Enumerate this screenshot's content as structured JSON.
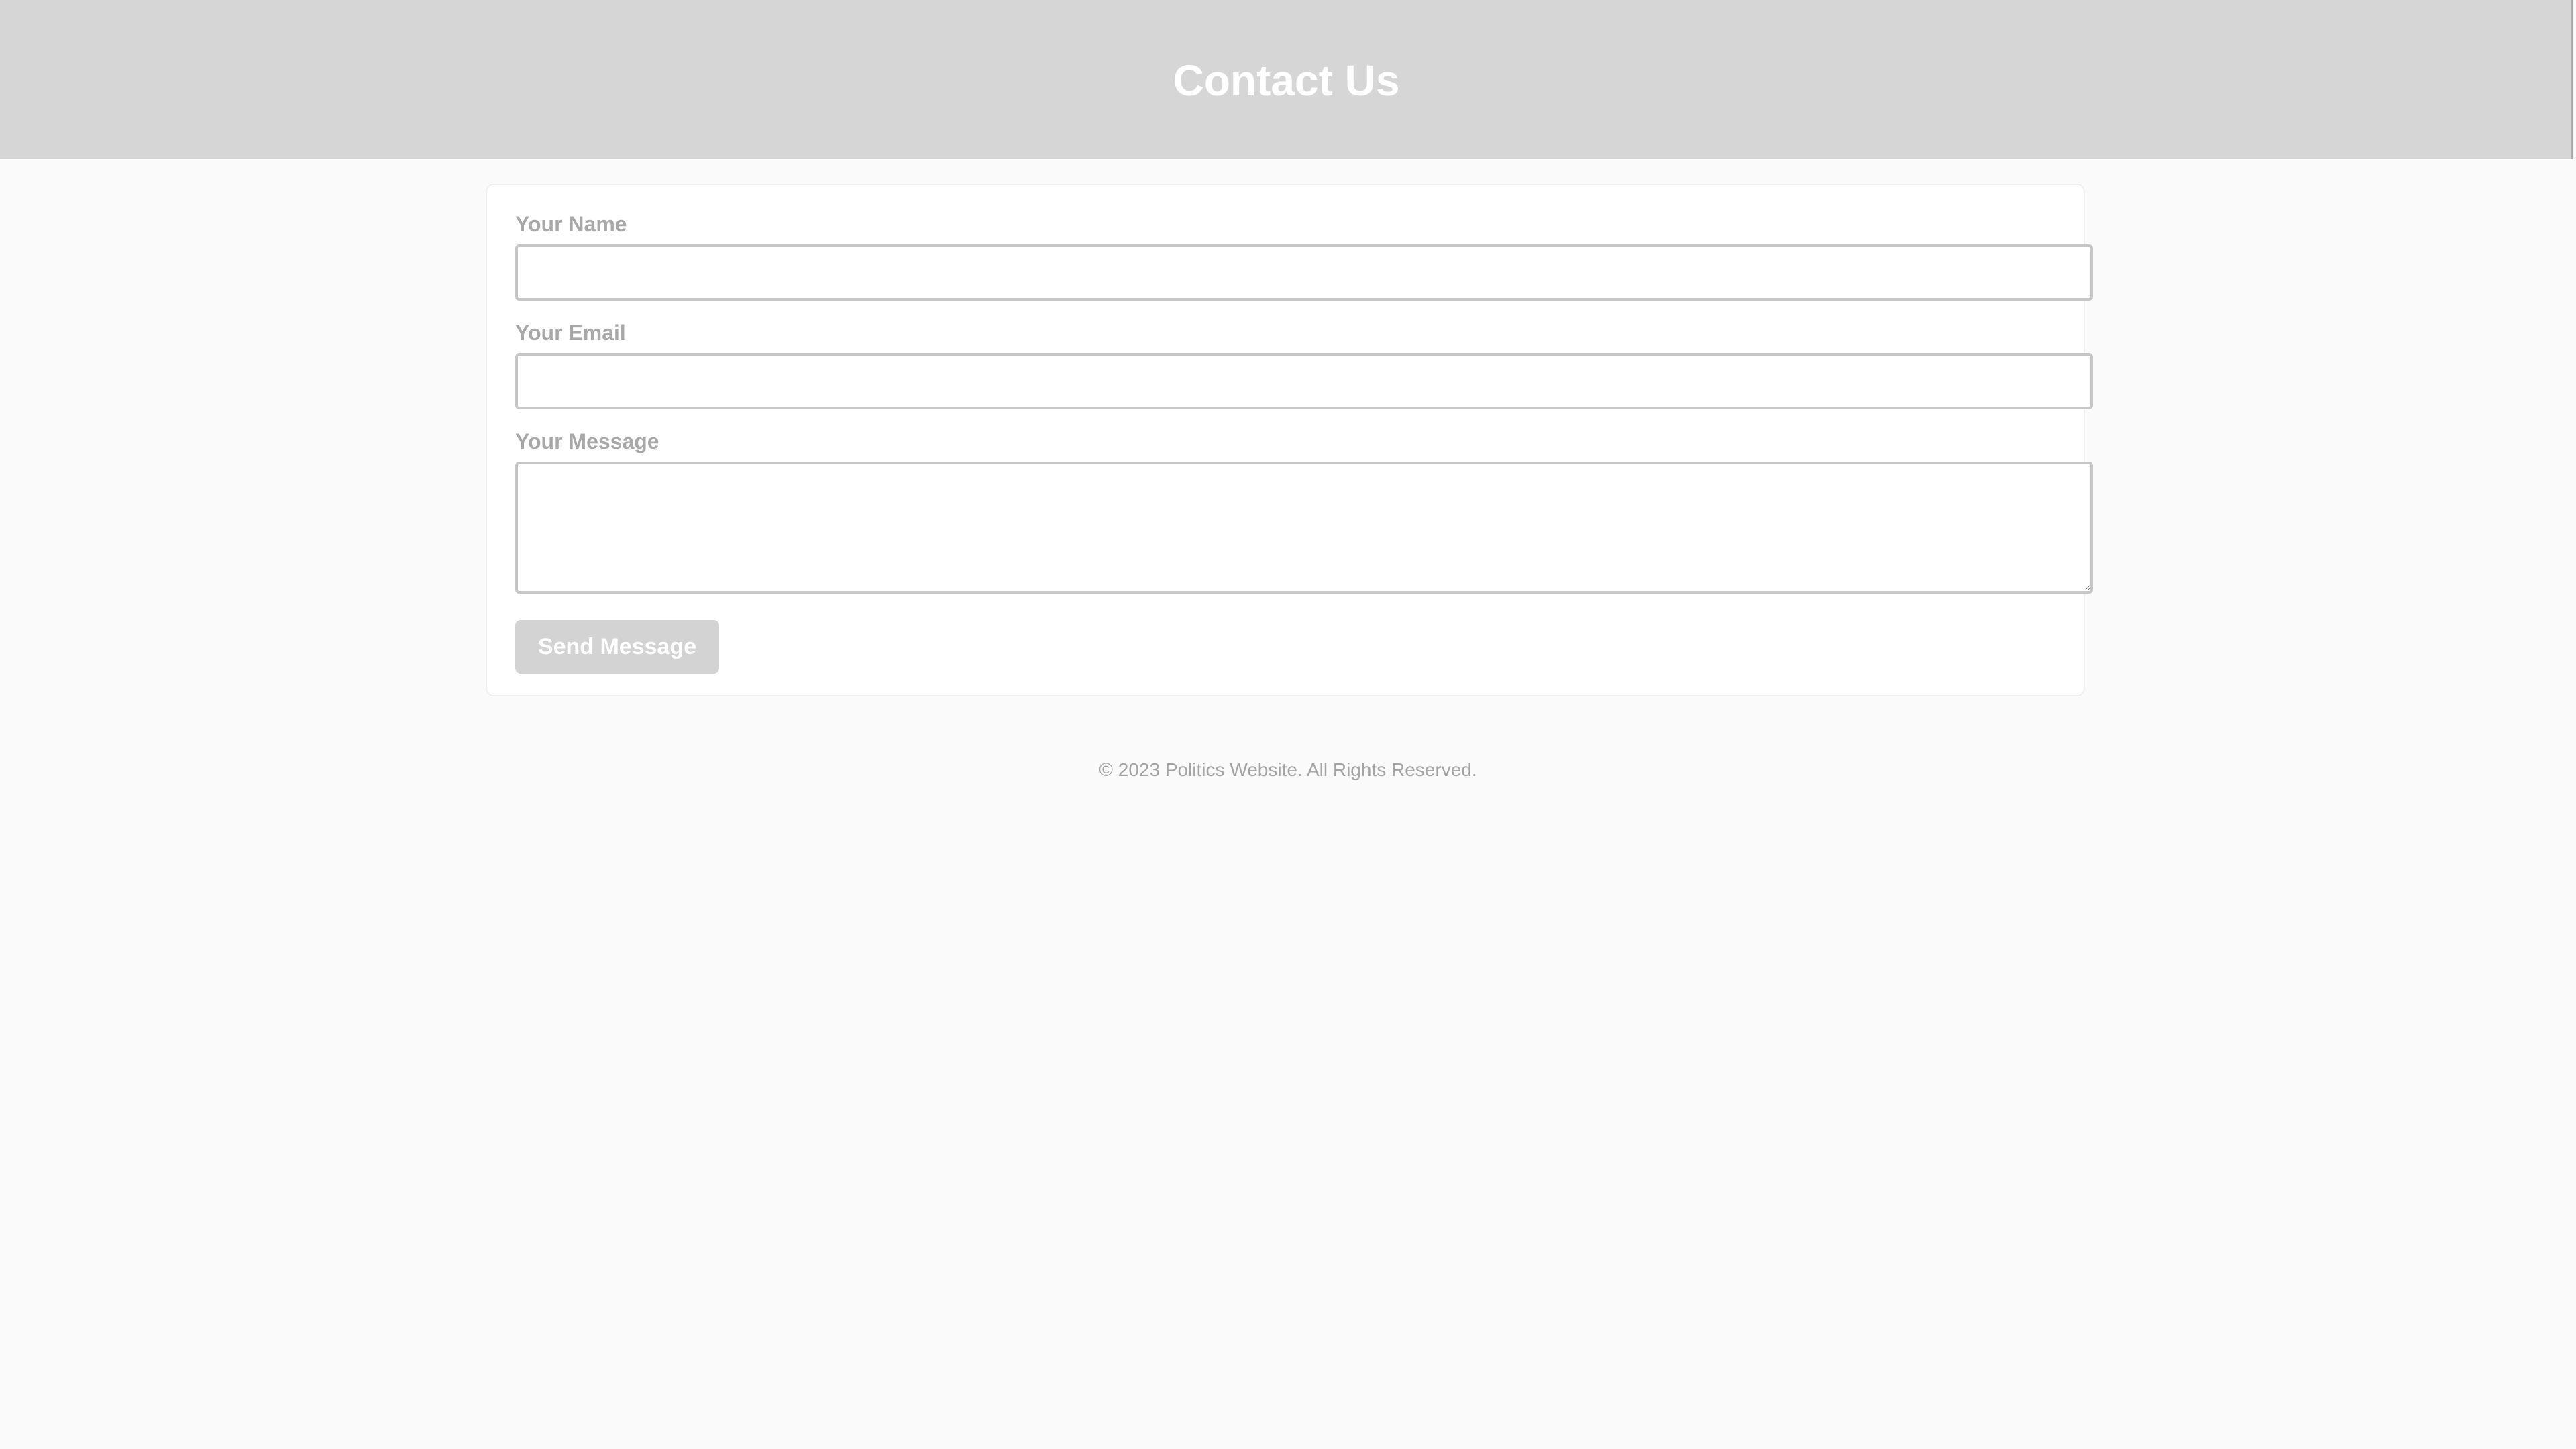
{
  "header": {
    "title": "Contact Us"
  },
  "form": {
    "name": {
      "label": "Your Name",
      "value": "",
      "placeholder": ""
    },
    "email": {
      "label": "Your Email",
      "value": "",
      "placeholder": ""
    },
    "message": {
      "label": "Your Message",
      "value": "",
      "placeholder": ""
    },
    "submit_label": "Send Message"
  },
  "footer": {
    "text": "© 2023 Politics Website. All Rights Reserved."
  },
  "colors": {
    "header_background": "#d6d6d6",
    "page_background": "#fafafa",
    "button_background": "#d3d3d3"
  }
}
